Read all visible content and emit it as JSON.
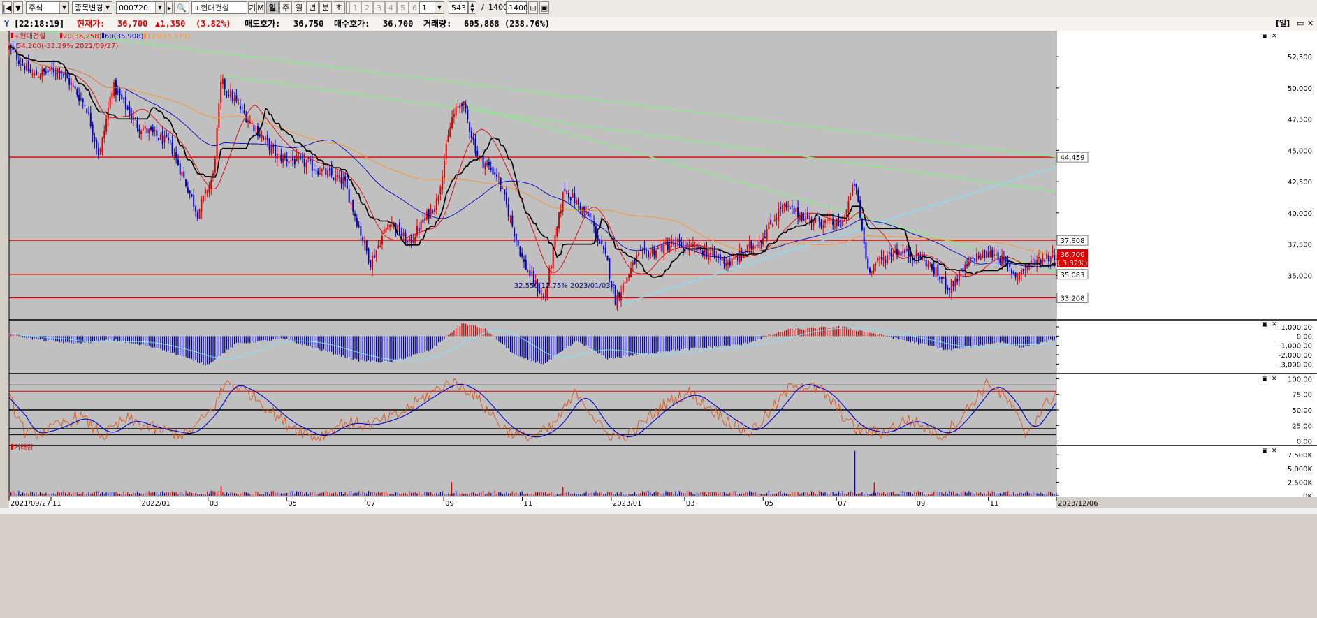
{
  "toolbar": {
    "market": "주식",
    "change_stock": "종목변경",
    "code": "000720",
    "name": "+현대건설",
    "m_label": "기",
    "m2_label": "M",
    "periods": [
      "일",
      "주",
      "월",
      "년",
      "분",
      "초",
      "틱"
    ],
    "active_period": "일",
    "nums": [
      "1",
      "2",
      "3",
      "4",
      "5",
      "6"
    ],
    "num_select": "1",
    "count": "543",
    "slash": "/",
    "total": "1400",
    "total_box": "1400"
  },
  "info": {
    "time": "[22:18:19]",
    "price_label": "현재가:",
    "price": "36,700",
    "change": "▲1,350",
    "pct": "(3.82%)",
    "ask_label": "매도호가:",
    "ask": "36,750",
    "bid_label": "매수호가:",
    "bid": "36,700",
    "vol_label": "거래량:",
    "vol": "605,868",
    "vol_pct": "(238.76%)",
    "right_label": "[일]",
    "colors": {
      "up": "#e00000",
      "down": "#0000c8",
      "ma20": "#e00000",
      "ma60": "#0000c8",
      "ma120": "#ff9020",
      "trend_green": "#80f080",
      "trend_cyan": "#80e0ff",
      "hline": "#e00000"
    }
  },
  "chart_data": [
    {
      "type": "candlestick",
      "title": "+현대건설",
      "legend": [
        "+현대건설",
        "20(36,258)",
        "60(35,908)",
        "120(35,375)"
      ],
      "x_ticks": [
        "2021/09/27",
        "11",
        "2022/01",
        "03",
        "05",
        "07",
        "09",
        "11",
        "2023/01",
        "03",
        "05",
        "07",
        "09",
        "11",
        "2023/12/06"
      ],
      "x_range": [
        "2021/09/27",
        "2023/12/06"
      ],
      "ylim": [
        31500,
        54800
      ],
      "y_ticks": [
        52500,
        50000,
        47500,
        45000,
        42500,
        40000,
        37500,
        35000
      ],
      "y_tick_labels": [
        "52,500",
        "50,000",
        "47,500",
        "45,000",
        "42,500",
        "40,000",
        "37,500",
        "35,000"
      ],
      "high_annotation": "54,200(-32.29% 2021/09/27)",
      "low_annotation": "32,550(12.75% 2023/01/03)",
      "horizontal_lines": [
        44459,
        37808,
        35083,
        33208
      ],
      "horizontal_labels": [
        "44,459",
        "37,808",
        "35,083",
        "33,208"
      ],
      "current_price": "36,700",
      "current_pct": "( 3.82%)",
      "price_path": [
        {
          "date": "2021/09/27",
          "close": 53200
        },
        {
          "date": "2021/10/15",
          "close": 51000
        },
        {
          "date": "2021/11/05",
          "close": 51500
        },
        {
          "date": "2021/11/25",
          "close": 48500
        },
        {
          "date": "2021/12/05",
          "close": 44500
        },
        {
          "date": "2021/12/15",
          "close": 50200
        },
        {
          "date": "2022/01/03",
          "close": 47000
        },
        {
          "date": "2022/01/28",
          "close": 45500
        },
        {
          "date": "2022/02/18",
          "close": 40000
        },
        {
          "date": "2022/03/02",
          "close": 43000
        },
        {
          "date": "2022/03/08",
          "close": 50500
        },
        {
          "date": "2022/03/25",
          "close": 48000
        },
        {
          "date": "2022/04/20",
          "close": 44500
        },
        {
          "date": "2022/05/10",
          "close": 44000
        },
        {
          "date": "2022/06/10",
          "close": 42500
        },
        {
          "date": "2022/06/30",
          "close": 36000
        },
        {
          "date": "2022/07/15",
          "close": 39500
        },
        {
          "date": "2022/07/29",
          "close": 37500
        },
        {
          "date": "2022/08/20",
          "close": 41000
        },
        {
          "date": "2022/08/31",
          "close": 47500
        },
        {
          "date": "2022/09/08",
          "close": 49000
        },
        {
          "date": "2022/09/20",
          "close": 44500
        },
        {
          "date": "2022/10/05",
          "close": 43000
        },
        {
          "date": "2022/10/25",
          "close": 36000
        },
        {
          "date": "2022/11/10",
          "close": 33000
        },
        {
          "date": "2022/11/25",
          "close": 42000
        },
        {
          "date": "2022/12/15",
          "close": 39500
        },
        {
          "date": "2022/12/28",
          "close": 36000
        },
        {
          "date": "2023/01/03",
          "close": 33000
        },
        {
          "date": "2023/01/20",
          "close": 36500
        },
        {
          "date": "2023/02/15",
          "close": 37500
        },
        {
          "date": "2023/03/10",
          "close": 37000
        },
        {
          "date": "2023/04/01",
          "close": 36000
        },
        {
          "date": "2023/04/25",
          "close": 38000
        },
        {
          "date": "2023/05/10",
          "close": 40500
        },
        {
          "date": "2023/06/01",
          "close": 39500
        },
        {
          "date": "2023/06/25",
          "close": 39000
        },
        {
          "date": "2023/07/05",
          "close": 42500
        },
        {
          "date": "2023/07/15",
          "close": 35500
        },
        {
          "date": "2023/08/05",
          "close": 37000
        },
        {
          "date": "2023/08/25",
          "close": 36500
        },
        {
          "date": "2023/09/15",
          "close": 34000
        },
        {
          "date": "2023/10/05",
          "close": 36500
        },
        {
          "date": "2023/10/20",
          "close": 36800
        },
        {
          "date": "2023/11/05",
          "close": 35000
        },
        {
          "date": "2023/11/20",
          "close": 36200
        },
        {
          "date": "2023/12/06",
          "close": 36700
        }
      ]
    },
    {
      "type": "bar",
      "name": "oscillator",
      "ylim": [
        -3800,
        1600
      ],
      "y_ticks": [
        1000,
        0,
        -1000,
        -2000,
        -3000
      ],
      "y_tick_labels": [
        "1,000.00",
        "0.00",
        "-1,000.00",
        "-2,000.00",
        "-3,000.00"
      ],
      "values": [
        {
          "date": "2021/09/27",
          "value": 300
        },
        {
          "date": "2021/10/15",
          "value": -300
        },
        {
          "date": "2021/11/15",
          "value": -800
        },
        {
          "date": "2021/12/15",
          "value": -400
        },
        {
          "date": "2022/01/20",
          "value": -1300
        },
        {
          "date": "2022/02/25",
          "value": -3100
        },
        {
          "date": "2022/03/20",
          "value": -800
        },
        {
          "date": "2022/04/25",
          "value": -300
        },
        {
          "date": "2022/06/20",
          "value": -2600
        },
        {
          "date": "2022/07/15",
          "value": -2800
        },
        {
          "date": "2022/08/15",
          "value": -1500
        },
        {
          "date": "2022/09/08",
          "value": 1400
        },
        {
          "date": "2022/09/25",
          "value": 800
        },
        {
          "date": "2022/10/20",
          "value": -2200
        },
        {
          "date": "2022/11/10",
          "value": -3000
        },
        {
          "date": "2022/12/05",
          "value": -500
        },
        {
          "date": "2022/12/28",
          "value": -2400
        },
        {
          "date": "2023/02/10",
          "value": -1600
        },
        {
          "date": "2023/04/10",
          "value": -900
        },
        {
          "date": "2023/05/15",
          "value": 700
        },
        {
          "date": "2023/06/25",
          "value": 1000
        },
        {
          "date": "2023/07/25",
          "value": 100
        },
        {
          "date": "2023/09/15",
          "value": -1500
        },
        {
          "date": "2023/10/25",
          "value": -600
        },
        {
          "date": "2023/11/10",
          "value": -1200
        },
        {
          "date": "2023/12/06",
          "value": -300
        }
      ]
    },
    {
      "type": "line",
      "name": "stochastic",
      "ylim": [
        -5,
        105
      ],
      "y_ticks": [
        100,
        75,
        50,
        25,
        0
      ],
      "y_tick_labels": [
        "100.00",
        "75.00",
        "50.00",
        "25.00",
        "0.00"
      ],
      "reference_lines": [
        90,
        80,
        50,
        20,
        10
      ],
      "values": [
        {
          "date": "2021/09/27",
          "value": 70
        },
        {
          "date": "2021/10/10",
          "value": 10
        },
        {
          "date": "2021/10/28",
          "value": 18
        },
        {
          "date": "2021/11/20",
          "value": 40
        },
        {
          "date": "2021/12/08",
          "value": 8
        },
        {
          "date": "2021/12/25",
          "value": 35
        },
        {
          "date": "2022/01/15",
          "value": 20
        },
        {
          "date": "2022/02/10",
          "value": 10
        },
        {
          "date": "2022/03/01",
          "value": 50
        },
        {
          "date": "2022/03/12",
          "value": 95
        },
        {
          "date": "2022/04/01",
          "value": 75
        },
        {
          "date": "2022/04/25",
          "value": 30
        },
        {
          "date": "2022/05/20",
          "value": 5
        },
        {
          "date": "2022/06/10",
          "value": 30
        },
        {
          "date": "2022/06/28",
          "value": 25
        },
        {
          "date": "2022/07/20",
          "value": 40
        },
        {
          "date": "2022/08/10",
          "value": 70
        },
        {
          "date": "2022/08/30",
          "value": 95
        },
        {
          "date": "2022/09/15",
          "value": 80
        },
        {
          "date": "2022/10/10",
          "value": 20
        },
        {
          "date": "2022/10/28",
          "value": 3
        },
        {
          "date": "2022/11/15",
          "value": 20
        },
        {
          "date": "2022/12/05",
          "value": 80
        },
        {
          "date": "2022/12/25",
          "value": 15
        },
        {
          "date": "2023/01/10",
          "value": 3
        },
        {
          "date": "2023/02/10",
          "value": 60
        },
        {
          "date": "2023/02/28",
          "value": 78
        },
        {
          "date": "2023/03/25",
          "value": 40
        },
        {
          "date": "2023/04/15",
          "value": 12
        },
        {
          "date": "2023/05/01",
          "value": 45
        },
        {
          "date": "2023/05/20",
          "value": 95
        },
        {
          "date": "2023/06/10",
          "value": 80
        },
        {
          "date": "2023/07/05",
          "value": 20
        },
        {
          "date": "2023/07/25",
          "value": 12
        },
        {
          "date": "2023/08/15",
          "value": 35
        },
        {
          "date": "2023/09/10",
          "value": 8
        },
        {
          "date": "2023/09/25",
          "value": 40
        },
        {
          "date": "2023/10/15",
          "value": 95
        },
        {
          "date": "2023/11/01",
          "value": 60
        },
        {
          "date": "2023/11/12",
          "value": 10
        },
        {
          "date": "2023/11/25",
          "value": 50
        },
        {
          "date": "2023/12/06",
          "value": 80
        }
      ]
    },
    {
      "type": "bar",
      "name": "거래량",
      "legend": [
        "거래량"
      ],
      "ylim": [
        0,
        8800
      ],
      "y_ticks": [
        7500,
        5000,
        2500,
        0
      ],
      "y_tick_labels": [
        "7,500K",
        "5,000K",
        "2,500K",
        "0K"
      ],
      "spikes": [
        {
          "date": "2022/03/08",
          "value": 1800
        },
        {
          "date": "2022/08/31",
          "value": 2500
        },
        {
          "date": "2022/11/24",
          "value": 1600
        },
        {
          "date": "2023/07/05",
          "value": 8200
        },
        {
          "date": "2023/07/20",
          "value": 2500
        }
      ]
    }
  ]
}
